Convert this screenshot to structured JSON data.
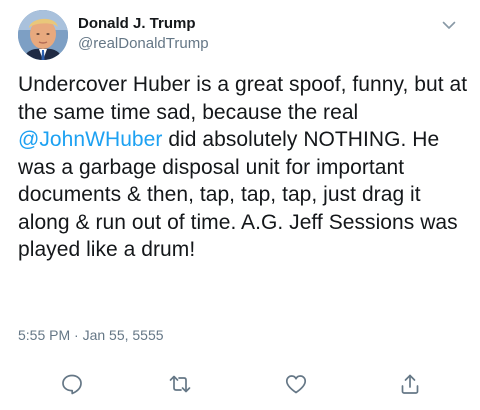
{
  "tweet": {
    "author": {
      "display_name": "Donald J. Trump",
      "handle": "@realDonaldTrump",
      "avatar_icon": "profile-photo"
    },
    "text_before_mention": "Undercover Huber is a great spoof, funny, but at the same time sad, because the real ",
    "mention": "@JohnWHuber",
    "text_after_mention": " did absolutely NOTHING. He was a garbage disposal unit for important documents & then, tap, tap, tap, just drag it along & run out of time. A.G. Jeff Sessions was played like a drum!",
    "timestamp": "5:55 PM · Jan 55, 5555",
    "menu_icon": "chevron-down-icon",
    "actions": [
      {
        "name": "reply",
        "icon": "reply-icon"
      },
      {
        "name": "retweet",
        "icon": "retweet-icon"
      },
      {
        "name": "like",
        "icon": "heart-icon"
      },
      {
        "name": "share",
        "icon": "share-icon"
      }
    ]
  },
  "colors": {
    "text": "#14171a",
    "secondary": "#657786",
    "link": "#1da1f2",
    "icon": "#657786"
  }
}
